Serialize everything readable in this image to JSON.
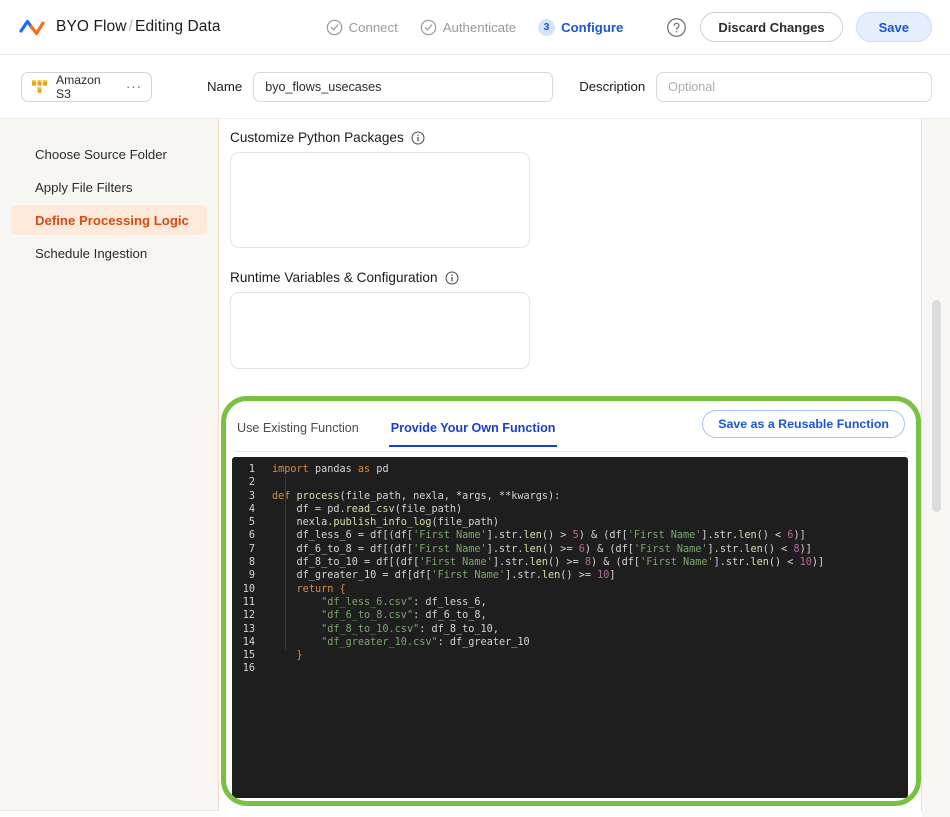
{
  "header": {
    "logo_icon": "nexla-wave-logo",
    "breadcrumb_1": "BYO Flow",
    "breadcrumb_sep": "/",
    "breadcrumb_2": "Editing Data",
    "steps": [
      {
        "icon": "check-circle-icon",
        "label": "Connect",
        "state": "done"
      },
      {
        "icon": "check-circle-icon",
        "label": "Authenticate",
        "state": "done"
      },
      {
        "num": "3",
        "label": "Configure",
        "state": "current"
      }
    ],
    "help_icon": "question-circle-icon",
    "discard_label": "Discard Changes",
    "save_label": "Save"
  },
  "subbar": {
    "source_icon": "amazon-s3-icon",
    "source_name": "Amazon S3",
    "overflow_dots": "···",
    "name_label": "Name",
    "name_value": "byo_flows_usecases",
    "description_label": "Description",
    "description_placeholder": "Optional",
    "description_value": ""
  },
  "sidebar": {
    "items": [
      {
        "label": "Choose Source Folder",
        "active": false
      },
      {
        "label": "Apply File Filters",
        "active": false
      },
      {
        "label": "Define Processing Logic",
        "active": true
      },
      {
        "label": "Schedule Ingestion",
        "active": false
      }
    ]
  },
  "main": {
    "python_packages": {
      "title": "Customize Python Packages",
      "info_icon": "info-circle-icon",
      "value": "",
      "placeholder": ""
    },
    "runtime_vars": {
      "title": "Runtime Variables & Configuration",
      "info_icon": "info-circle-icon",
      "value": "",
      "placeholder": ""
    },
    "function_card": {
      "tabs": [
        {
          "label": "Use Existing Function",
          "active": false
        },
        {
          "label": "Provide Your Own Function",
          "active": true
        }
      ],
      "reusable_button": "Save as a Reusable Function",
      "highlight_color": "#7ac143",
      "editor": {
        "background": "#1e1e1e",
        "line_number_color": "#b8738f",
        "total_lines": 16,
        "lines": [
          {
            "n": "1",
            "tokens": [
              {
                "t": "import",
                "c": "k"
              },
              {
                "t": " pandas ",
                "c": "pl"
              },
              {
                "t": "as",
                "c": "k"
              },
              {
                "t": " pd",
                "c": "pl"
              }
            ]
          },
          {
            "n": "2",
            "tokens": []
          },
          {
            "n": "3",
            "tokens": [
              {
                "t": "def",
                "c": "k"
              },
              {
                "t": " ",
                "c": "pl"
              },
              {
                "t": "process",
                "c": "fn"
              },
              {
                "t": "(file_path, nexla, *args, **kwargs):",
                "c": "pl"
              }
            ]
          },
          {
            "n": "4",
            "tokens": [
              {
                "t": "    df = pd.",
                "c": "pl"
              },
              {
                "t": "read_csv",
                "c": "fn"
              },
              {
                "t": "(file_path)",
                "c": "pl"
              }
            ]
          },
          {
            "n": "5",
            "tokens": [
              {
                "t": "    nexla.",
                "c": "pl"
              },
              {
                "t": "publish_info_log",
                "c": "fn"
              },
              {
                "t": "(file_path)",
                "c": "pl"
              }
            ]
          },
          {
            "n": "6",
            "tokens": [
              {
                "t": "    df_less_6 = df[(df[",
                "c": "pl"
              },
              {
                "t": "'First Name'",
                "c": "st"
              },
              {
                "t": "].str.",
                "c": "pl"
              },
              {
                "t": "len",
                "c": "fn"
              },
              {
                "t": "() > ",
                "c": "pl"
              },
              {
                "t": "5",
                "c": "nu"
              },
              {
                "t": ") & (df[",
                "c": "pl"
              },
              {
                "t": "'First Name'",
                "c": "st"
              },
              {
                "t": "].str.",
                "c": "pl"
              },
              {
                "t": "len",
                "c": "fn"
              },
              {
                "t": "() < ",
                "c": "pl"
              },
              {
                "t": "6",
                "c": "nu"
              },
              {
                "t": ")]",
                "c": "pl"
              }
            ]
          },
          {
            "n": "7",
            "tokens": [
              {
                "t": "    df_6_to_8 = df[(df[",
                "c": "pl"
              },
              {
                "t": "'First Name'",
                "c": "st"
              },
              {
                "t": "].str.",
                "c": "pl"
              },
              {
                "t": "len",
                "c": "fn"
              },
              {
                "t": "() >= ",
                "c": "pl"
              },
              {
                "t": "6",
                "c": "nu"
              },
              {
                "t": ") & (df[",
                "c": "pl"
              },
              {
                "t": "'First Name'",
                "c": "st"
              },
              {
                "t": "].str.",
                "c": "pl"
              },
              {
                "t": "len",
                "c": "fn"
              },
              {
                "t": "() < ",
                "c": "pl"
              },
              {
                "t": "8",
                "c": "nu"
              },
              {
                "t": ")]",
                "c": "pl"
              }
            ]
          },
          {
            "n": "8",
            "tokens": [
              {
                "t": "    df_8_to_10 = df[(df[",
                "c": "pl"
              },
              {
                "t": "'First Name'",
                "c": "st"
              },
              {
                "t": "].str.",
                "c": "pl"
              },
              {
                "t": "len",
                "c": "fn"
              },
              {
                "t": "() >= ",
                "c": "pl"
              },
              {
                "t": "8",
                "c": "nu"
              },
              {
                "t": ") & (df[",
                "c": "pl"
              },
              {
                "t": "'First Name'",
                "c": "st"
              },
              {
                "t": "].str.",
                "c": "pl"
              },
              {
                "t": "len",
                "c": "fn"
              },
              {
                "t": "() < ",
                "c": "pl"
              },
              {
                "t": "10",
                "c": "nu"
              },
              {
                "t": ")]",
                "c": "pl"
              }
            ]
          },
          {
            "n": "9",
            "tokens": [
              {
                "t": "    df_greater_10 = df[df[",
                "c": "pl"
              },
              {
                "t": "'First Name'",
                "c": "st"
              },
              {
                "t": "].str.",
                "c": "pl"
              },
              {
                "t": "len",
                "c": "fn"
              },
              {
                "t": "() >= ",
                "c": "pl"
              },
              {
                "t": "10",
                "c": "nu"
              },
              {
                "t": "]",
                "c": "pl"
              }
            ]
          },
          {
            "n": "10",
            "tokens": [
              {
                "t": "    ",
                "c": "pl"
              },
              {
                "t": "return",
                "c": "k"
              },
              {
                "t": " ",
                "c": "pl"
              },
              {
                "t": "{",
                "c": "br"
              }
            ]
          },
          {
            "n": "11",
            "tokens": [
              {
                "t": "        ",
                "c": "pl"
              },
              {
                "t": "\"df_less_6.csv\"",
                "c": "st"
              },
              {
                "t": ": df_less_6,",
                "c": "pl"
              }
            ]
          },
          {
            "n": "12",
            "tokens": [
              {
                "t": "        ",
                "c": "pl"
              },
              {
                "t": "\"df_6_to_8.csv\"",
                "c": "st"
              },
              {
                "t": ": df_6_to_8,",
                "c": "pl"
              }
            ]
          },
          {
            "n": "13",
            "tokens": [
              {
                "t": "        ",
                "c": "pl"
              },
              {
                "t": "\"df_8_to_10.csv\"",
                "c": "st"
              },
              {
                "t": ": df_8_to_10,",
                "c": "pl"
              }
            ]
          },
          {
            "n": "14",
            "tokens": [
              {
                "t": "        ",
                "c": "pl"
              },
              {
                "t": "\"df_greater_10.csv\"",
                "c": "st"
              },
              {
                "t": ": df_greater_10",
                "c": "pl"
              }
            ]
          },
          {
            "n": "15",
            "tokens": [
              {
                "t": "    ",
                "c": "pl"
              },
              {
                "t": "}",
                "c": "br"
              }
            ]
          },
          {
            "n": "16",
            "tokens": []
          }
        ]
      }
    }
  }
}
